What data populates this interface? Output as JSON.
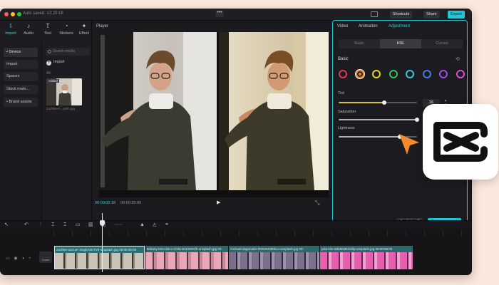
{
  "window": {
    "project_name": "Auto saved: 12:20:18",
    "shortcuts_label": "Shortcuts",
    "share_label": "Share",
    "export_label": "Export"
  },
  "left_tabs": [
    {
      "label": "Import",
      "icon": "import-icon",
      "glyph": "⇩"
    },
    {
      "label": "Audio",
      "icon": "audio-icon",
      "glyph": "♪"
    },
    {
      "label": "Text",
      "icon": "text-icon",
      "glyph": "T"
    },
    {
      "label": "Stickers",
      "icon": "stickers-icon",
      "glyph": "◔"
    },
    {
      "label": "Effect",
      "icon": "effect-icon",
      "glyph": "✦"
    }
  ],
  "side_menu": [
    {
      "label": "• Device"
    },
    {
      "label": "Import"
    },
    {
      "label": "Spaces"
    },
    {
      "label": "Stock mate..."
    },
    {
      "label": "• Brand assets"
    }
  ],
  "media": {
    "search_placeholder": "Search media",
    "import_label": "Import",
    "all_label": "All",
    "thumb_badge": "Added",
    "thumb_name": "zachlen-n...yash.jpg"
  },
  "player": {
    "title": "Player",
    "time_current": "00:00:02:18",
    "time_total": "00:00:20:00"
  },
  "panel": {
    "tabs": [
      "Video",
      "Animation",
      "Adjustment"
    ],
    "segments": [
      "Basic",
      "HSL",
      "Curves"
    ],
    "section_title": "Basic",
    "colors": [
      "#e0385a",
      "#f08a24",
      "#e6d520",
      "#37c45a",
      "#2ec9d6",
      "#3d7be8",
      "#9a4ee6",
      "#e04ad6"
    ],
    "tint_label": "Tint",
    "tint_value": "26",
    "tint_level": 0.58,
    "saturation_label": "Saturation",
    "saturation_level": 1.0,
    "lightness_label": "Lightness",
    "lightness_level": 0.78,
    "apply_all_label": "Apply to all",
    "save_preset_label": "Save as preset"
  },
  "timeline": {
    "cover_label": "Cover",
    "clips": [
      {
        "label": "zachlen-anzuer-4mghA0H7V0-unsplash.jpg 00:00:05:00",
        "color": "#2b6f73"
      },
      {
        "label": "brittany-tem-dob-v-Oz5c4mKSOGlh-unsplash.jpg  00:",
        "color": "#2a6a6e"
      },
      {
        "label": "michael-dagonakis-R8GSVM9SLo-unsplash.jpg  00:",
        "color": "#2a6a6e"
      },
      {
        "label": "julia-kim-9d4MIMkGSilp-unsplash.jpg  00:00:05:00",
        "color": "#2a6a6e"
      }
    ]
  }
}
